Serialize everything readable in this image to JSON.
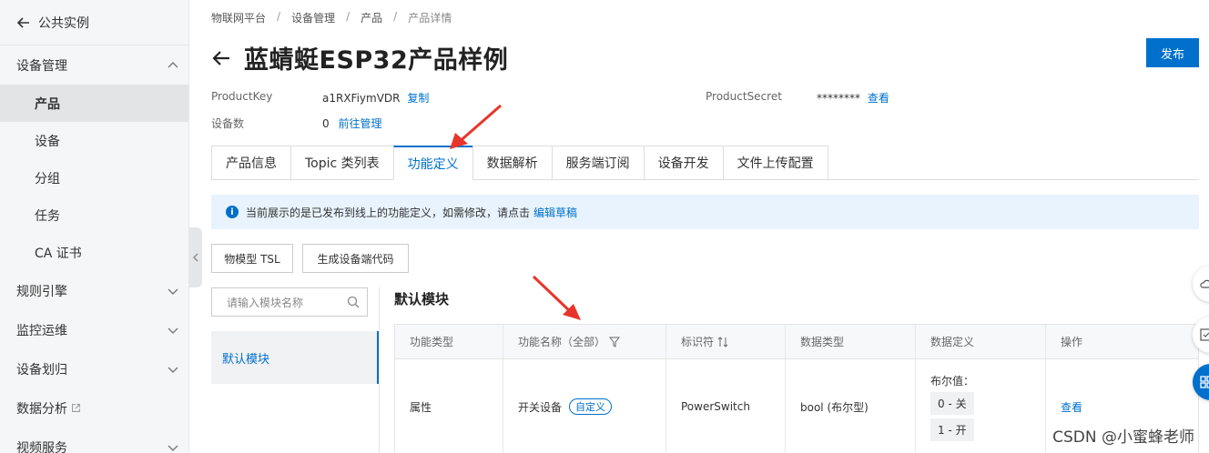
{
  "sidebar": {
    "back_label": "公共实例",
    "groups": [
      {
        "label": "设备管理",
        "expanded": true
      },
      {
        "label": "规则引擎"
      },
      {
        "label": "监控运维"
      },
      {
        "label": "设备划归"
      },
      {
        "label": "数据分析"
      },
      {
        "label": "视频服务"
      }
    ],
    "items": [
      "产品",
      "设备",
      "分组",
      "任务",
      "CA 证书"
    ],
    "active_item": "产品"
  },
  "breadcrumb": [
    "物联网平台",
    "设备管理",
    "产品",
    "产品详情"
  ],
  "page": {
    "title": "蓝蜻蜓ESP32产品样例",
    "publish_label": "发布"
  },
  "meta": {
    "product_key_label": "ProductKey",
    "product_key_value": "a1RXFiymVDR",
    "copy_label": "复制",
    "device_count_label": "设备数",
    "device_count_value": "0",
    "manage_label": "前往管理",
    "product_secret_label": "ProductSecret",
    "product_secret_value": "********",
    "view_label": "查看"
  },
  "tabs": [
    "产品信息",
    "Topic 类列表",
    "功能定义",
    "数据解析",
    "服务端订阅",
    "设备开发",
    "文件上传配置"
  ],
  "active_tab": "功能定义",
  "notice": {
    "text": "当前展示的是已发布到线上的功能定义，如需修改，请点击",
    "link": "编辑草稿"
  },
  "buttons": {
    "tsl": "物模型 TSL",
    "gen_code": "生成设备端代码"
  },
  "search": {
    "placeholder": "请输入模块名称"
  },
  "modules": [
    "默认模块"
  ],
  "module_title": "默认模块",
  "table": {
    "headers": [
      "功能类型",
      "功能名称（全部）",
      "标识符",
      "数据类型",
      "数据定义",
      "操作"
    ],
    "rows": [
      {
        "type": "属性",
        "name": "开关设备",
        "badge": "自定义",
        "identifier": "PowerSwitch",
        "data_type": "bool (布尔型)",
        "def_label": "布尔值：",
        "def_values": [
          "0 - 关",
          "1 - 开"
        ],
        "action": "查看"
      }
    ]
  },
  "watermark": "CSDN @小蜜蜂老师",
  "colors": {
    "accent": "#0070cc",
    "arrow": "#e8352b"
  }
}
